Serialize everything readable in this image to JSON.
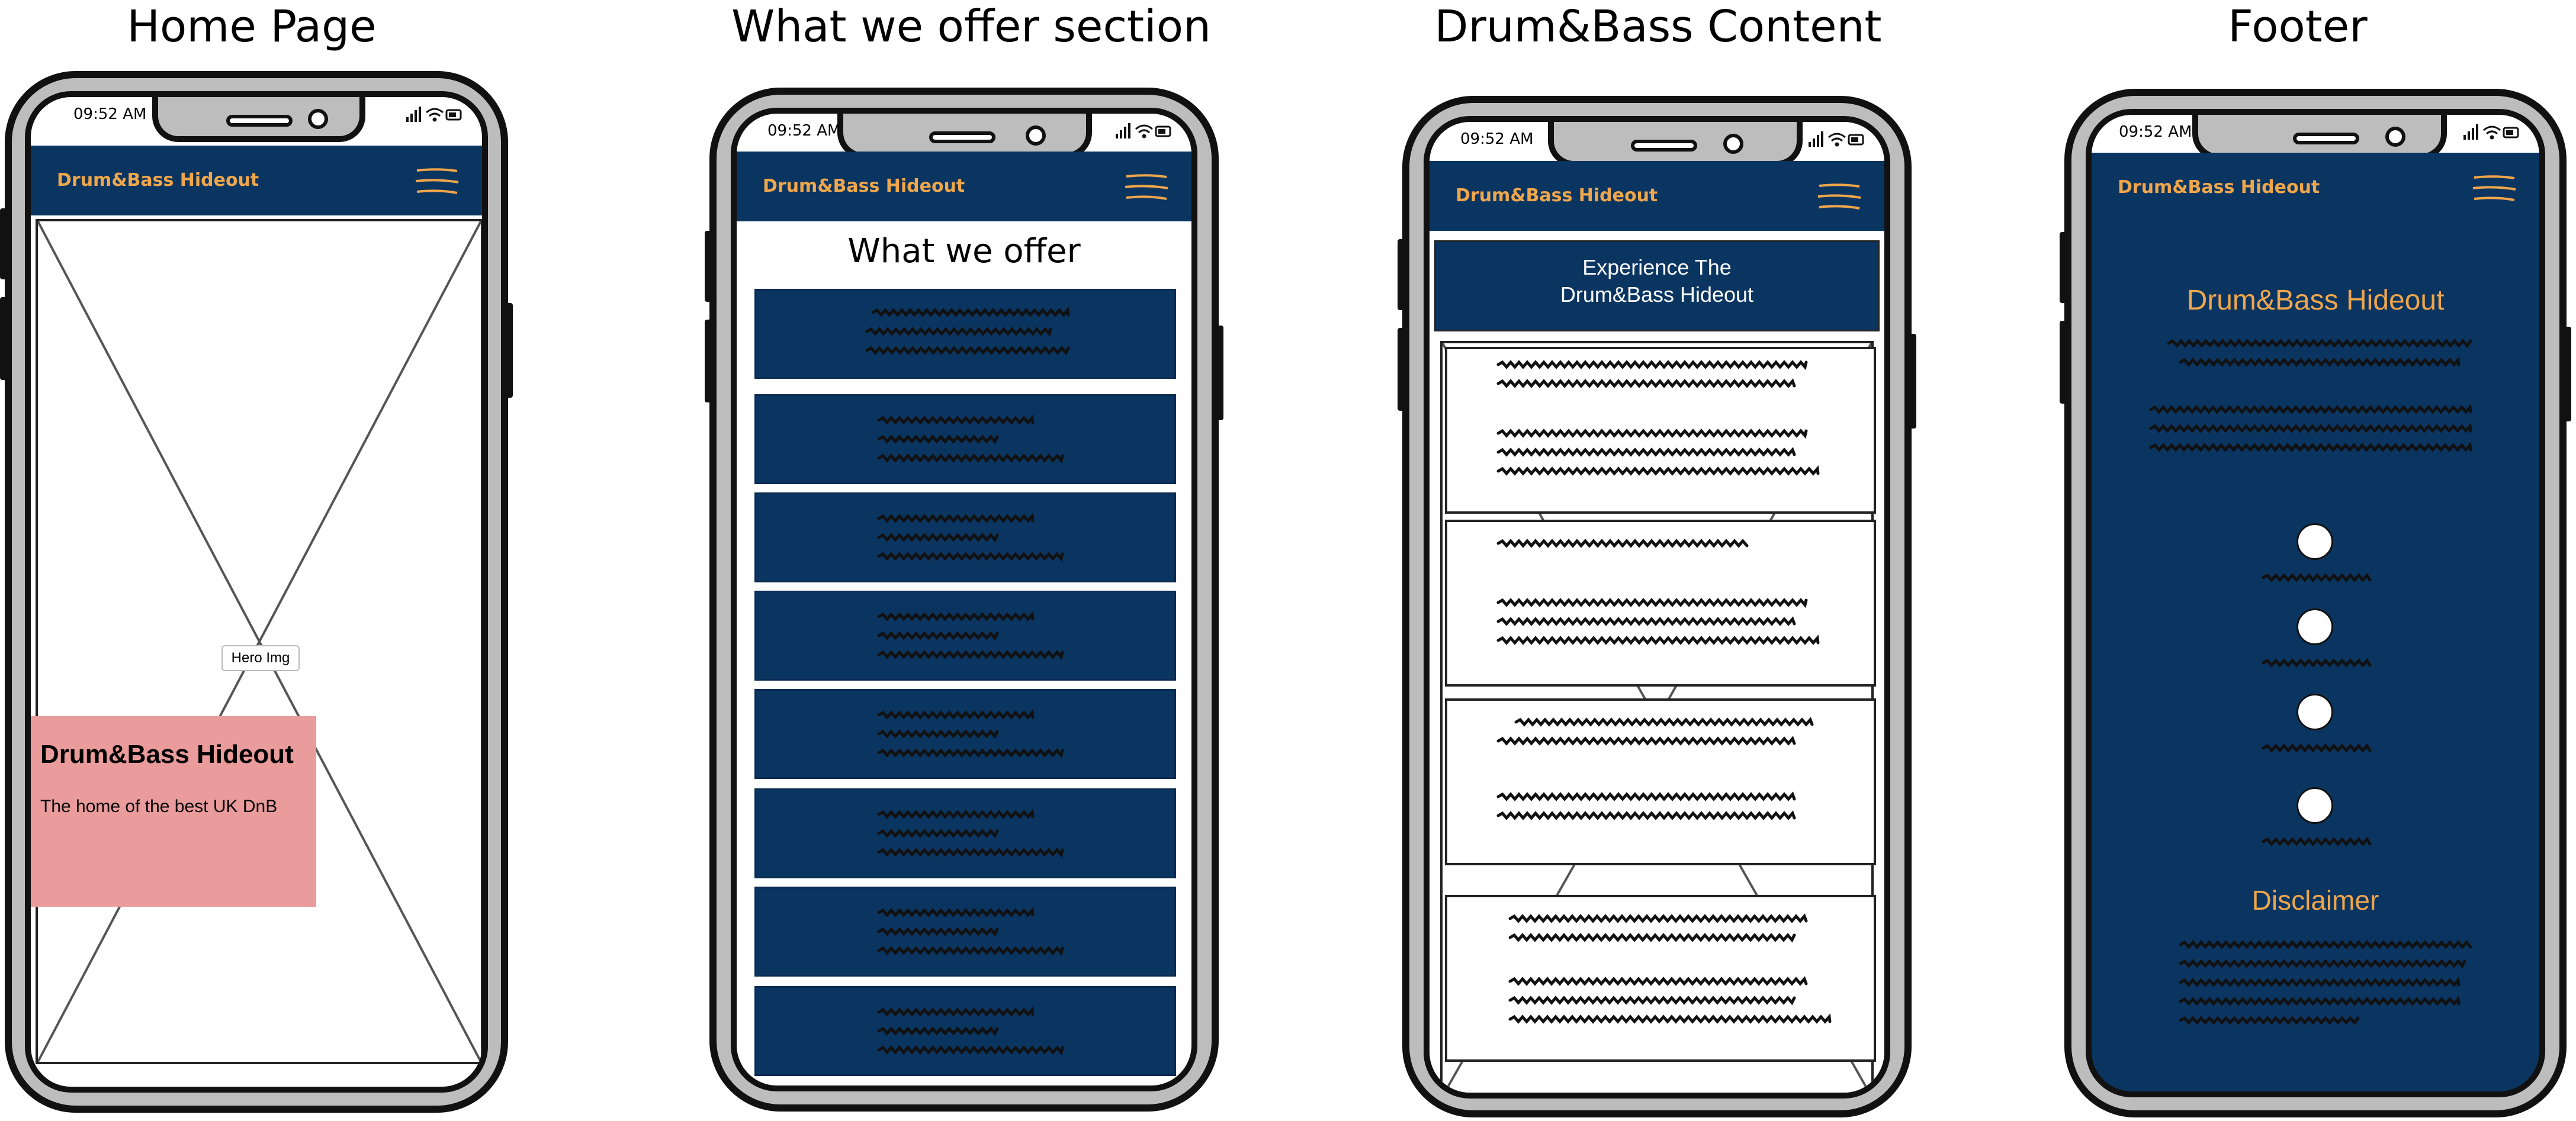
{
  "titles": [
    "Home Page",
    "What we offer section",
    "Drum&Bass Content",
    "Footer"
  ],
  "status_time": "09:52 AM",
  "brand": "Drum&Bass Hideout",
  "home": {
    "hero_label": "Hero Img",
    "hero_title": "Drum&Bass Hideout",
    "hero_subtitle": "The home of the best UK DnB",
    "hero_box_color": "#ea9b9b"
  },
  "offer": {
    "heading": "What we offer",
    "cards_count_label": "8"
  },
  "content": {
    "banner_line1": "Experience The",
    "banner_line2": "Drum&Bass Hideout"
  },
  "footer": {
    "title": "Drum&Bass Hideout",
    "disclaimer": "Disclaimer"
  },
  "colors": {
    "navy": "#0b3561",
    "accent": "#f0a64b",
    "frame": "#bdbdbd",
    "hero_box": "#ea9b9b"
  },
  "icons": [
    "hamburger-menu-icon",
    "signal-icon",
    "wifi-icon",
    "battery-icon",
    "camera-icon",
    "speaker-icon"
  ]
}
